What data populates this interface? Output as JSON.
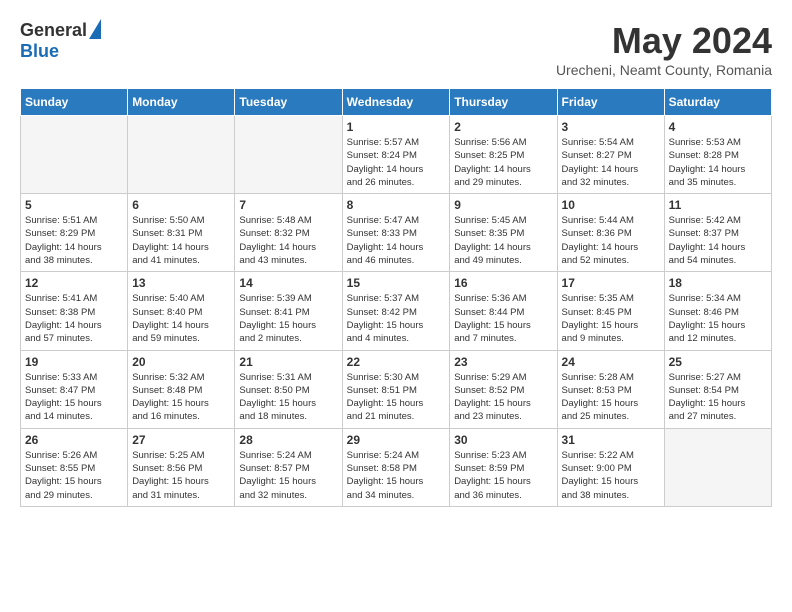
{
  "logo": {
    "general": "General",
    "blue": "Blue"
  },
  "title": "May 2024",
  "location": "Urecheni, Neamt County, Romania",
  "days_of_week": [
    "Sunday",
    "Monday",
    "Tuesday",
    "Wednesday",
    "Thursday",
    "Friday",
    "Saturday"
  ],
  "weeks": [
    [
      {
        "day": "",
        "info": ""
      },
      {
        "day": "",
        "info": ""
      },
      {
        "day": "",
        "info": ""
      },
      {
        "day": "1",
        "info": "Sunrise: 5:57 AM\nSunset: 8:24 PM\nDaylight: 14 hours\nand 26 minutes."
      },
      {
        "day": "2",
        "info": "Sunrise: 5:56 AM\nSunset: 8:25 PM\nDaylight: 14 hours\nand 29 minutes."
      },
      {
        "day": "3",
        "info": "Sunrise: 5:54 AM\nSunset: 8:27 PM\nDaylight: 14 hours\nand 32 minutes."
      },
      {
        "day": "4",
        "info": "Sunrise: 5:53 AM\nSunset: 8:28 PM\nDaylight: 14 hours\nand 35 minutes."
      }
    ],
    [
      {
        "day": "5",
        "info": "Sunrise: 5:51 AM\nSunset: 8:29 PM\nDaylight: 14 hours\nand 38 minutes."
      },
      {
        "day": "6",
        "info": "Sunrise: 5:50 AM\nSunset: 8:31 PM\nDaylight: 14 hours\nand 41 minutes."
      },
      {
        "day": "7",
        "info": "Sunrise: 5:48 AM\nSunset: 8:32 PM\nDaylight: 14 hours\nand 43 minutes."
      },
      {
        "day": "8",
        "info": "Sunrise: 5:47 AM\nSunset: 8:33 PM\nDaylight: 14 hours\nand 46 minutes."
      },
      {
        "day": "9",
        "info": "Sunrise: 5:45 AM\nSunset: 8:35 PM\nDaylight: 14 hours\nand 49 minutes."
      },
      {
        "day": "10",
        "info": "Sunrise: 5:44 AM\nSunset: 8:36 PM\nDaylight: 14 hours\nand 52 minutes."
      },
      {
        "day": "11",
        "info": "Sunrise: 5:42 AM\nSunset: 8:37 PM\nDaylight: 14 hours\nand 54 minutes."
      }
    ],
    [
      {
        "day": "12",
        "info": "Sunrise: 5:41 AM\nSunset: 8:38 PM\nDaylight: 14 hours\nand 57 minutes."
      },
      {
        "day": "13",
        "info": "Sunrise: 5:40 AM\nSunset: 8:40 PM\nDaylight: 14 hours\nand 59 minutes."
      },
      {
        "day": "14",
        "info": "Sunrise: 5:39 AM\nSunset: 8:41 PM\nDaylight: 15 hours\nand 2 minutes."
      },
      {
        "day": "15",
        "info": "Sunrise: 5:37 AM\nSunset: 8:42 PM\nDaylight: 15 hours\nand 4 minutes."
      },
      {
        "day": "16",
        "info": "Sunrise: 5:36 AM\nSunset: 8:44 PM\nDaylight: 15 hours\nand 7 minutes."
      },
      {
        "day": "17",
        "info": "Sunrise: 5:35 AM\nSunset: 8:45 PM\nDaylight: 15 hours\nand 9 minutes."
      },
      {
        "day": "18",
        "info": "Sunrise: 5:34 AM\nSunset: 8:46 PM\nDaylight: 15 hours\nand 12 minutes."
      }
    ],
    [
      {
        "day": "19",
        "info": "Sunrise: 5:33 AM\nSunset: 8:47 PM\nDaylight: 15 hours\nand 14 minutes."
      },
      {
        "day": "20",
        "info": "Sunrise: 5:32 AM\nSunset: 8:48 PM\nDaylight: 15 hours\nand 16 minutes."
      },
      {
        "day": "21",
        "info": "Sunrise: 5:31 AM\nSunset: 8:50 PM\nDaylight: 15 hours\nand 18 minutes."
      },
      {
        "day": "22",
        "info": "Sunrise: 5:30 AM\nSunset: 8:51 PM\nDaylight: 15 hours\nand 21 minutes."
      },
      {
        "day": "23",
        "info": "Sunrise: 5:29 AM\nSunset: 8:52 PM\nDaylight: 15 hours\nand 23 minutes."
      },
      {
        "day": "24",
        "info": "Sunrise: 5:28 AM\nSunset: 8:53 PM\nDaylight: 15 hours\nand 25 minutes."
      },
      {
        "day": "25",
        "info": "Sunrise: 5:27 AM\nSunset: 8:54 PM\nDaylight: 15 hours\nand 27 minutes."
      }
    ],
    [
      {
        "day": "26",
        "info": "Sunrise: 5:26 AM\nSunset: 8:55 PM\nDaylight: 15 hours\nand 29 minutes."
      },
      {
        "day": "27",
        "info": "Sunrise: 5:25 AM\nSunset: 8:56 PM\nDaylight: 15 hours\nand 31 minutes."
      },
      {
        "day": "28",
        "info": "Sunrise: 5:24 AM\nSunset: 8:57 PM\nDaylight: 15 hours\nand 32 minutes."
      },
      {
        "day": "29",
        "info": "Sunrise: 5:24 AM\nSunset: 8:58 PM\nDaylight: 15 hours\nand 34 minutes."
      },
      {
        "day": "30",
        "info": "Sunrise: 5:23 AM\nSunset: 8:59 PM\nDaylight: 15 hours\nand 36 minutes."
      },
      {
        "day": "31",
        "info": "Sunrise: 5:22 AM\nSunset: 9:00 PM\nDaylight: 15 hours\nand 38 minutes."
      },
      {
        "day": "",
        "info": ""
      }
    ]
  ]
}
